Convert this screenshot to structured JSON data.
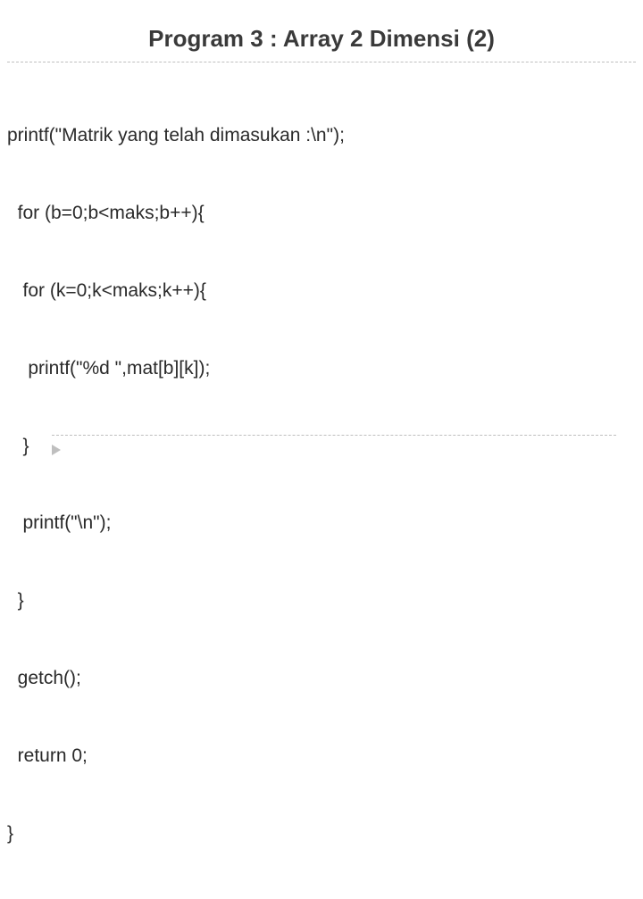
{
  "title": "Program 3 : Array 2 Dimensi (2)",
  "code": {
    "lines": [
      "printf(\"Matrik yang telah dimasukan :\\n\");",
      "  for (b=0;b<maks;b++){",
      "   for (k=0;k<maks;k++){",
      "    printf(\"%d \",mat[b][k]);",
      "   }",
      "   printf(\"\\n\");",
      "  }",
      "  getch();",
      "  return 0;",
      "}"
    ]
  }
}
